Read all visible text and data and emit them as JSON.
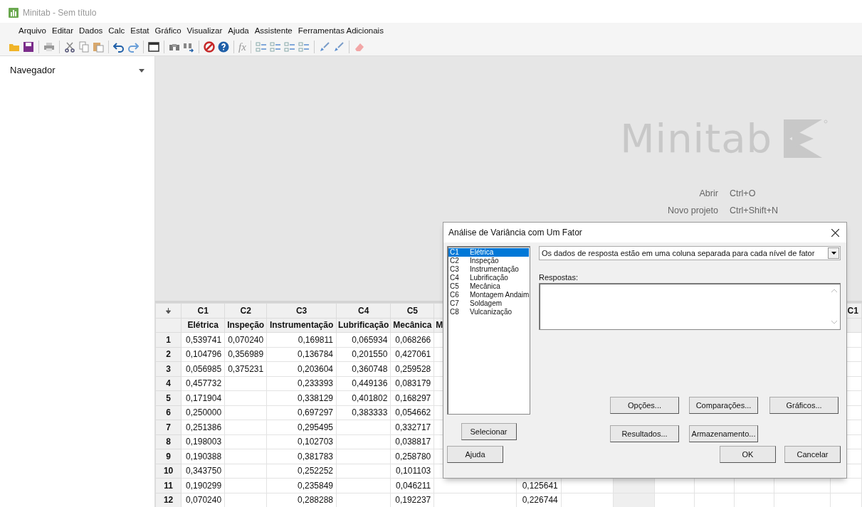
{
  "window": {
    "title": "Minitab - Sem título"
  },
  "menu": [
    "Arquivo",
    "Editar",
    "Dados",
    "Calc",
    "Estat",
    "Gráfico",
    "Visualizar",
    "Ajuda",
    "Assistente",
    "Ferramentas Adicionais"
  ],
  "toolbar": {
    "formula_label": "fx"
  },
  "navigator": {
    "title": "Navegador"
  },
  "start": {
    "logo": "Minitab",
    "shortcuts": [
      {
        "label": "Abrir",
        "keys": "Ctrl+O"
      },
      {
        "label": "Novo projeto",
        "keys": "Ctrl+Shift+N"
      }
    ]
  },
  "worksheet": {
    "columns": [
      {
        "id": "C1",
        "name": "Elétrica",
        "shaded": false
      },
      {
        "id": "C2",
        "name": "Inspeção",
        "shaded": false
      },
      {
        "id": "C3",
        "name": "Instrumentação",
        "shaded": false
      },
      {
        "id": "C4",
        "name": "Lubrificação",
        "shaded": false
      },
      {
        "id": "C5",
        "name": "Mecânica",
        "shaded": false
      },
      {
        "name": "M",
        "shaded": false
      },
      {
        "shaded": false
      },
      {
        "shaded": false
      },
      {
        "shaded": true
      },
      {
        "shaded": false
      },
      {
        "shaded": false
      },
      {
        "shaded": false
      },
      {
        "shaded": false
      },
      {
        "id": "C1",
        "shaded": false
      }
    ],
    "rows": [
      {
        "n": "1",
        "cells": [
          "0,539741",
          "0,070240",
          "0,169811",
          "0,065934",
          "0,068266"
        ]
      },
      {
        "n": "2",
        "cells": [
          "0,104796",
          "0,356989",
          "0,136784",
          "0,201550",
          "0,427061"
        ]
      },
      {
        "n": "3",
        "cells": [
          "0,056985",
          "0,375231",
          "0,203604",
          "0,360748",
          "0,259528"
        ]
      },
      {
        "n": "4",
        "cells": [
          "0,457732",
          null,
          "0,233393",
          "0,449136",
          "0,083179"
        ]
      },
      {
        "n": "5",
        "cells": [
          "0,171904",
          null,
          "0,338129",
          "0,401802",
          "0,168297"
        ]
      },
      {
        "n": "6",
        "cells": [
          "0,250000",
          null,
          "0,697297",
          "0,383333",
          "0,054662"
        ]
      },
      {
        "n": "7",
        "cells": [
          "0,251386",
          null,
          "0,295495",
          null,
          "0,332717"
        ]
      },
      {
        "n": "8",
        "cells": [
          "0,198003",
          null,
          "0,102703",
          null,
          "0,038817"
        ]
      },
      {
        "n": "9",
        "cells": [
          "0,190388",
          null,
          "0,381783",
          null,
          "0,258780"
        ]
      },
      {
        "n": "10",
        "cells": [
          "0,343750",
          null,
          "0,252252",
          null,
          "0,101103"
        ]
      },
      {
        "n": "11",
        "cells": [
          "0,190299",
          null,
          "0,235849",
          null,
          "0,046211",
          null,
          "0,125641"
        ]
      },
      {
        "n": "12",
        "cells": [
          "0,070240",
          null,
          "0,288288",
          null,
          "0,192237",
          null,
          "0,226744"
        ]
      }
    ]
  },
  "dialog": {
    "title": "Análise de Variância com Um Fator",
    "variables": [
      {
        "id": "C1",
        "name": "Elétrica",
        "selected": true
      },
      {
        "id": "C2",
        "name": "Inspeção",
        "selected": false
      },
      {
        "id": "C3",
        "name": "Instrumentação",
        "selected": false
      },
      {
        "id": "C4",
        "name": "Lubrificação",
        "selected": false
      },
      {
        "id": "C5",
        "name": "Mecânica",
        "selected": false
      },
      {
        "id": "C6",
        "name": "Montagem Andaim",
        "selected": false
      },
      {
        "id": "C7",
        "name": "Soldagem",
        "selected": false
      },
      {
        "id": "C8",
        "name": "Vulcanização",
        "selected": false
      }
    ],
    "layout_option": "Os dados de resposta estão em uma coluna separada para cada nível de fator",
    "responses_label": "Respostas:",
    "select_button": "Selecionar",
    "option_buttons": [
      [
        "Opções...",
        "Comparações...",
        "Gráficos..."
      ],
      [
        "Resultados...",
        "Armazenamento..."
      ]
    ],
    "help_button": "Ajuda",
    "ok_button": "OK",
    "cancel_button": "Cancelar"
  }
}
